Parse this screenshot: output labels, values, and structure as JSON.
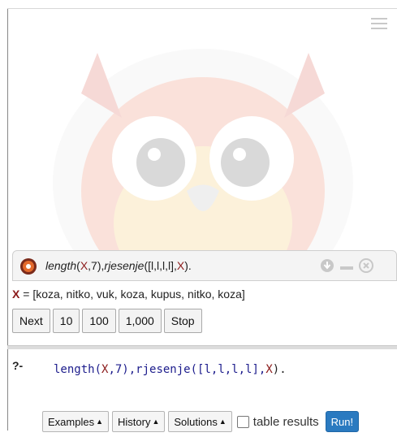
{
  "query": {
    "title_pred1": "length",
    "title_open1": "(",
    "title_var1": "X",
    "title_mid1": ",7),",
    "title_pred2": "rjesenje",
    "title_mid2": "([l,l,l,l],",
    "title_var2": "X",
    "title_end": ")."
  },
  "answer": {
    "var": "X",
    "eq": " = ",
    "value": "[koza, nitko, vuk, koza, kupus, nitko, koza]"
  },
  "buttons": {
    "next": "Next",
    "ten": "10",
    "hundred": "100",
    "thousand": "1,000",
    "stop": "Stop"
  },
  "editor": {
    "prompt": "?-",
    "p1": "length(",
    "v1": "X",
    "p2": ",7),rjesenje([l,l,l,l],",
    "v2": "X",
    "p3": ")."
  },
  "toolbar": {
    "examples": "Examples",
    "history": "History",
    "solutions": "Solutions",
    "table_results": "table results",
    "run": "Run!"
  },
  "colors": {
    "variable": "#8b1a1a",
    "run_button": "#2a7ac0"
  }
}
